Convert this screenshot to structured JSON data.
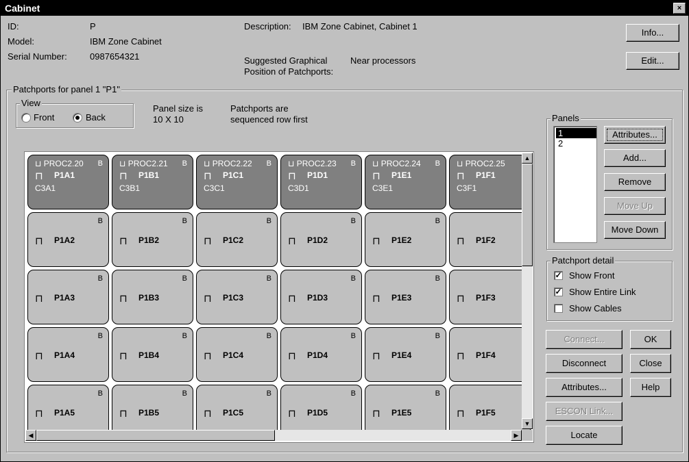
{
  "window": {
    "title": "Cabinet",
    "close_glyph": "×"
  },
  "info": {
    "id_label": "ID:",
    "id_value": "P",
    "model_label": "Model:",
    "model_value": "IBM Zone Cabinet",
    "serial_label": "Serial Number:",
    "serial_value": "0987654321",
    "desc_label": "Description:",
    "desc_value": "IBM Zone Cabinet, Cabinet 1",
    "sugg_label_1": "Suggested Graphical",
    "sugg_label_2": "Position of Patchports:",
    "sugg_value": "Near processors"
  },
  "buttons": {
    "info": "Info...",
    "edit": "Edit..."
  },
  "patchports_group": "Patchports for panel 1 \"P1\"",
  "view": {
    "caption": "View",
    "front": "Front",
    "back": "Back",
    "selected": "Back"
  },
  "panel_size": {
    "line1": "Panel size is",
    "line2": "10 X 10"
  },
  "sequence": {
    "line1": "Patchports are",
    "line2": "sequenced row first"
  },
  "grid": {
    "top_row": [
      {
        "proc": "PROC2.20",
        "side": "B",
        "port": "P1A1",
        "cable": "C3A1"
      },
      {
        "proc": "PROC2.21",
        "side": "B",
        "port": "P1B1",
        "cable": "C3B1"
      },
      {
        "proc": "PROC2.22",
        "side": "B",
        "port": "P1C1",
        "cable": "C3C1"
      },
      {
        "proc": "PROC2.23",
        "side": "B",
        "port": "P1D1",
        "cable": "C3D1"
      },
      {
        "proc": "PROC2.24",
        "side": "B",
        "port": "P1E1",
        "cable": "C3E1"
      },
      {
        "proc": "PROC2.25",
        "side": "",
        "port": "P1F1",
        "cable": "C3F1"
      }
    ],
    "rows": [
      [
        "P1A2",
        "P1B2",
        "P1C2",
        "P1D2",
        "P1E2",
        "P1F2"
      ],
      [
        "P1A3",
        "P1B3",
        "P1C3",
        "P1D3",
        "P1E3",
        "P1F3"
      ],
      [
        "P1A4",
        "P1B4",
        "P1C4",
        "P1D4",
        "P1E4",
        "P1F4"
      ],
      [
        "P1A5",
        "P1B5",
        "P1C5",
        "P1D5",
        "P1E5",
        "P1F5"
      ]
    ],
    "side_label": "B"
  },
  "panels": {
    "caption": "Panels",
    "items": [
      "1",
      "2"
    ],
    "selected": "1",
    "attributes": "Attributes...",
    "add": "Add...",
    "remove": "Remove",
    "move_up": "Move Up",
    "move_down": "Move Down"
  },
  "detail": {
    "caption": "Patchport detail",
    "show_front": "Show Front",
    "show_front_checked": true,
    "show_entire_link": "Show Entire Link",
    "show_entire_link_checked": true,
    "show_cables": "Show Cables",
    "show_cables_checked": false
  },
  "actions": {
    "connect": "Connect...",
    "ok": "OK",
    "disconnect": "Disconnect",
    "close": "Close",
    "attributes": "Attributes...",
    "help": "Help",
    "escon_link": "ESCON Link...",
    "locate": "Locate"
  },
  "colors": {
    "face": "#c0c0c0",
    "connected_cell": "#808080",
    "title_bar": "#000000"
  }
}
